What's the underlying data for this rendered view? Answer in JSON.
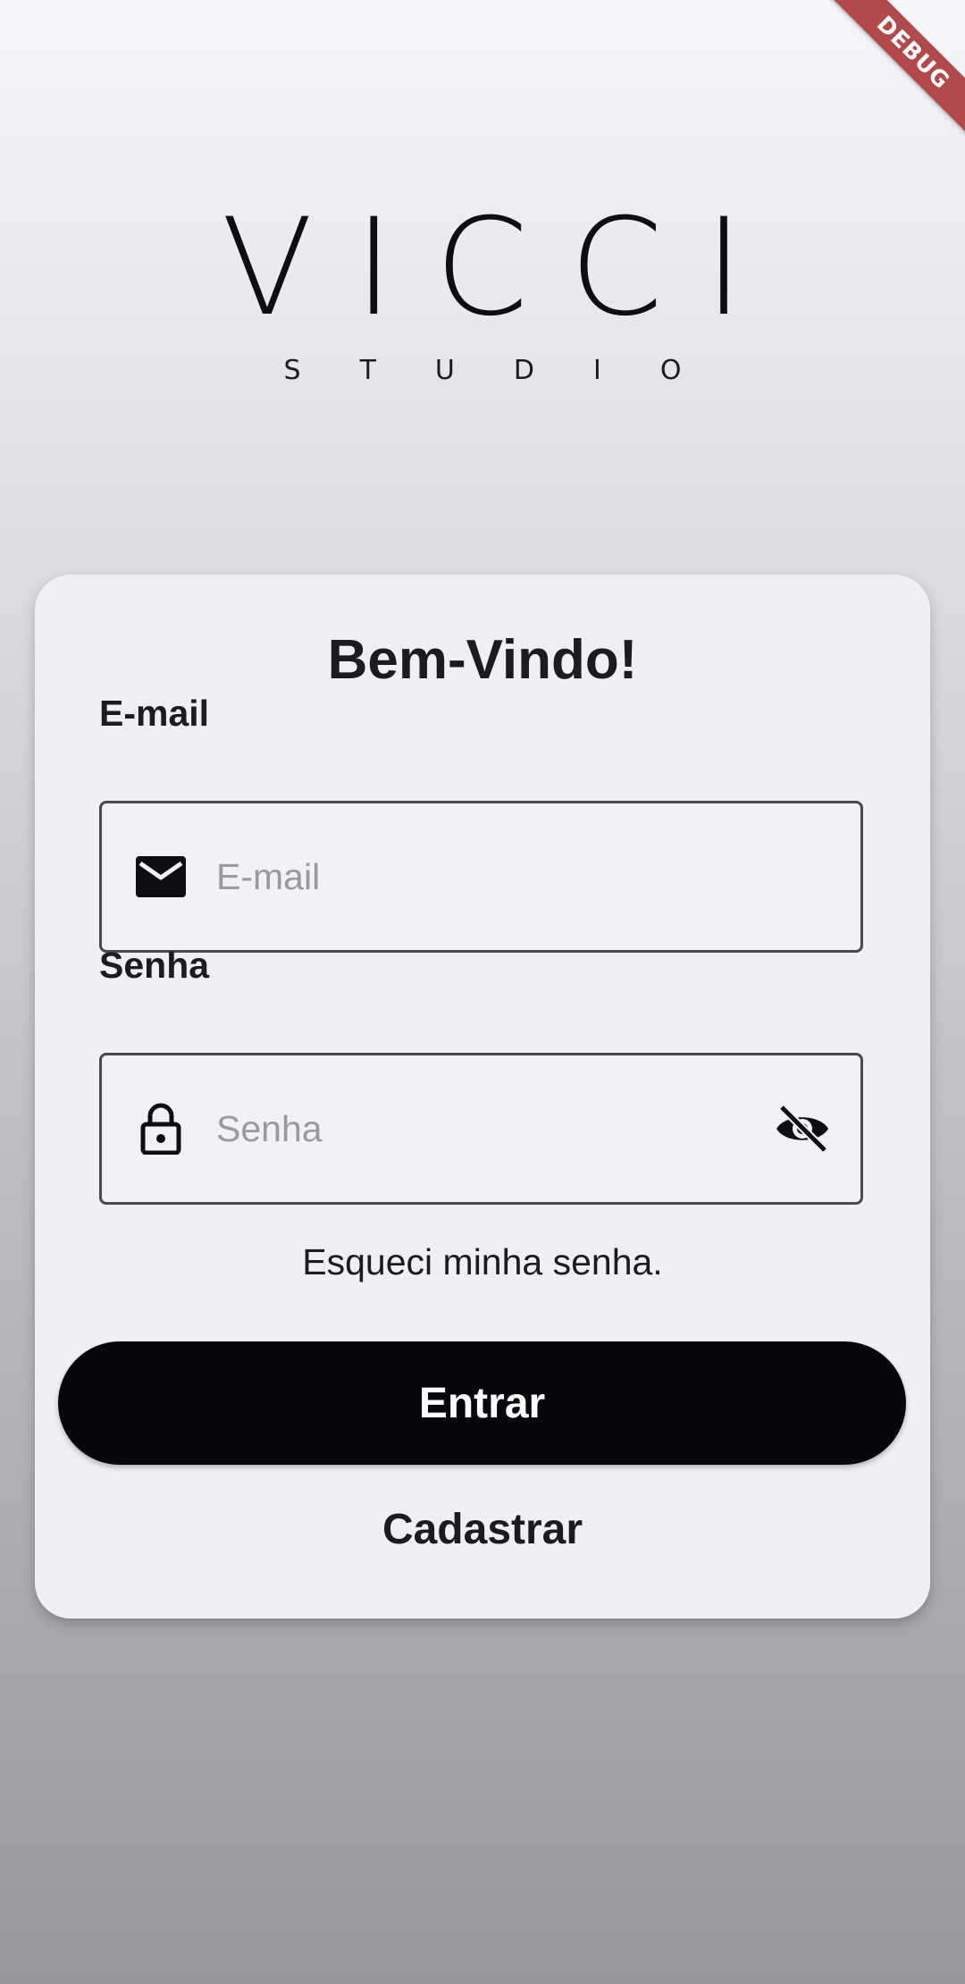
{
  "debug_banner": "DEBUG",
  "logo": {
    "word": "VICCI",
    "subtitle": "STUDIO"
  },
  "login": {
    "title": "Bem-Vindo!",
    "email": {
      "label": "E-mail",
      "placeholder": "E-mail",
      "value": "",
      "icon": "mail-icon"
    },
    "password": {
      "label": "Senha",
      "placeholder": "Senha",
      "value": "",
      "icon": "lock-icon",
      "toggle_icon": "visibility-off-icon"
    },
    "forgot_password": "Esqueci minha senha.",
    "submit_label": "Entrar",
    "register_label": "Cadastrar"
  },
  "colors": {
    "primary_button": "#07060b",
    "card_background": "#f0eff4",
    "debug_banner": "#b04a4b"
  }
}
